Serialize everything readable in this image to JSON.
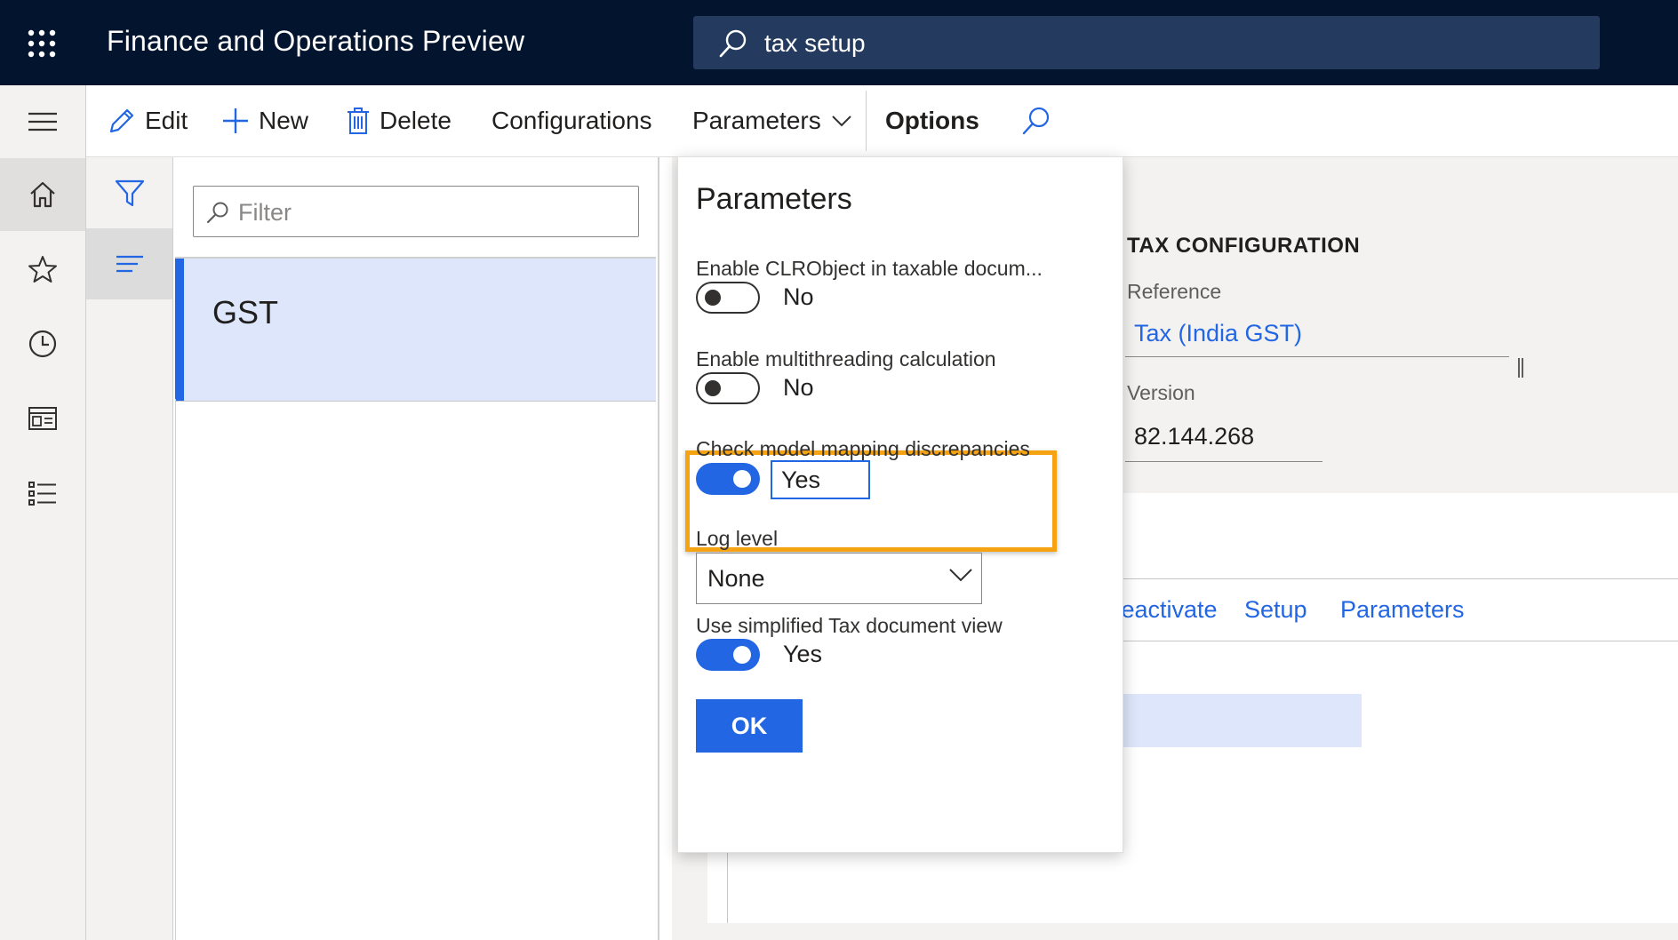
{
  "app": {
    "title": "Finance and Operations Preview",
    "search_value": "tax setup"
  },
  "nav": {
    "items": [
      "menu-icon",
      "home-icon",
      "star-icon",
      "clock-icon",
      "workspace-icon",
      "list-icon"
    ]
  },
  "actions": {
    "edit": "Edit",
    "new": "New",
    "delete": "Delete",
    "configurations": "Configurations",
    "parameters": "Parameters",
    "options": "Options"
  },
  "list": {
    "filter_placeholder": "Filter",
    "rows": [
      "GST"
    ]
  },
  "details": {
    "section_title": "TAX CONFIGURATION",
    "reference_label": "Reference",
    "reference_value": "Tax (India GST)",
    "version_label": "Version",
    "version_value": "82.144.268",
    "tabs": [
      "Deactivate",
      "Setup",
      "Parameters"
    ]
  },
  "flyout": {
    "title": "Parameters",
    "fields": [
      {
        "label": "Enable CLRObject in taxable docum...",
        "value": "No",
        "on": false
      },
      {
        "label": "Enable multithreading calculation",
        "value": "No",
        "on": false
      },
      {
        "label": "Check model mapping discrepancies",
        "value": "Yes",
        "on": true
      },
      {
        "label": "Use simplified Tax document view",
        "value": "Yes",
        "on": true
      }
    ],
    "log_level_label": "Log level",
    "log_level_value": "None",
    "ok_label": "OK"
  },
  "colors": {
    "topbar": "#03152e",
    "accent": "#2266e3",
    "highlight": "#f5a312"
  }
}
